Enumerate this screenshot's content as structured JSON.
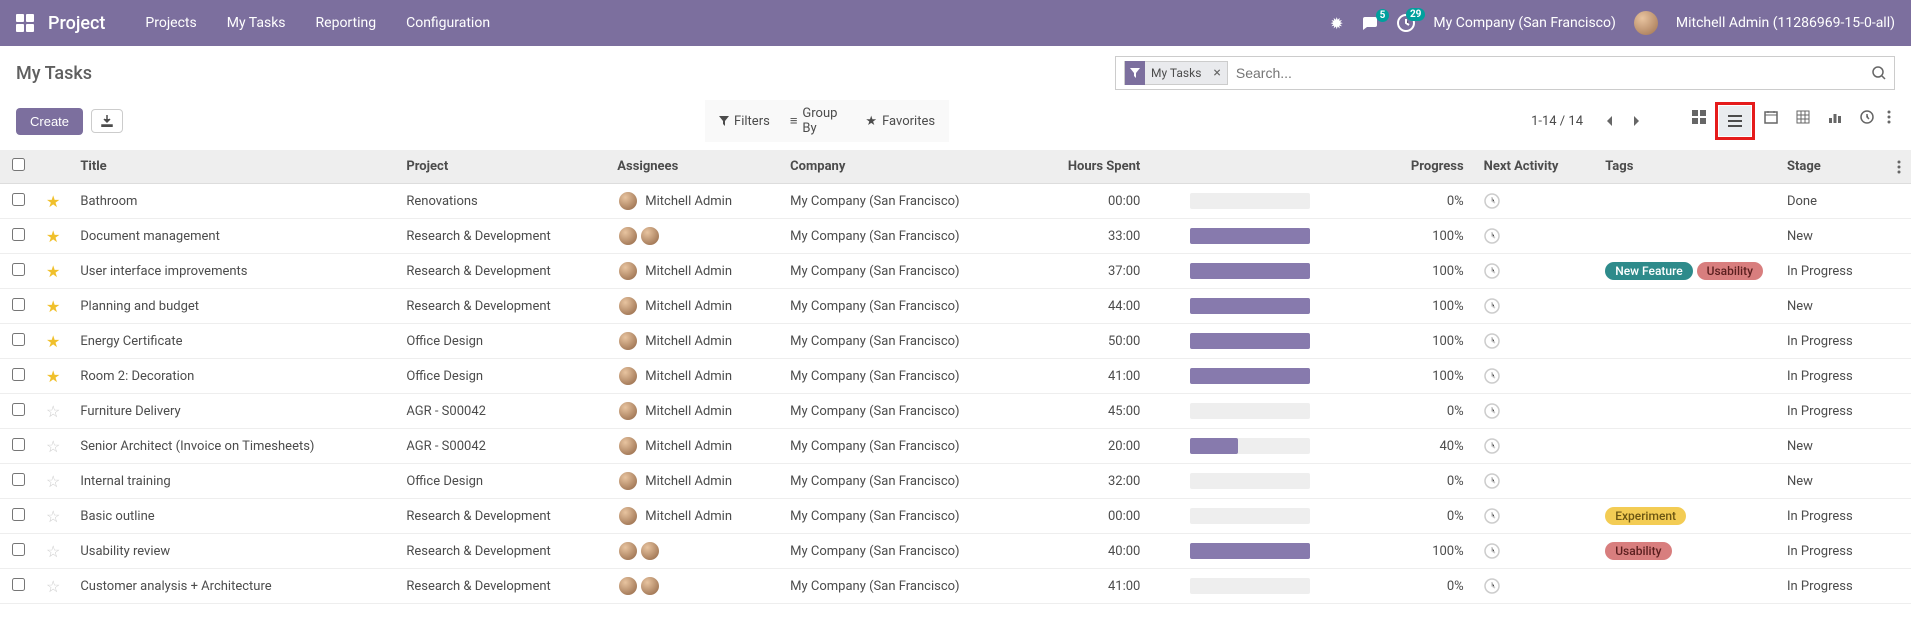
{
  "nav": {
    "brand": "Project",
    "menu": [
      "Projects",
      "My Tasks",
      "Reporting",
      "Configuration"
    ],
    "msg_badge": "5",
    "act_badge": "29",
    "company": "My Company (San Francisco)",
    "user": "Mitchell Admin (11286969-15-0-all)"
  },
  "breadcrumb": "My Tasks",
  "search": {
    "facet_label": "My Tasks",
    "placeholder": "Search..."
  },
  "buttons": {
    "create": "Create",
    "filters": "Filters",
    "groupby": "Group By",
    "favorites": "Favorites"
  },
  "pager": "1-14 / 14",
  "columns": {
    "title": "Title",
    "project": "Project",
    "assignees": "Assignees",
    "company": "Company",
    "hours": "Hours Spent",
    "progress": "Progress",
    "next_activity": "Next Activity",
    "tags": "Tags",
    "stage": "Stage"
  },
  "tag_colors": {
    "New Feature": "tag-teal",
    "Usability": "tag-red",
    "Experiment": "tag-yellow"
  },
  "rows": [
    {
      "star": true,
      "title": "Bathroom",
      "project": "Renovations",
      "assignees": [
        "Mitchell Admin"
      ],
      "show_name": true,
      "company": "My Company (San Francisco)",
      "hours": "00:00",
      "progress_pct": 0,
      "tags": [],
      "stage": "Done"
    },
    {
      "star": true,
      "title": "Document management",
      "project": "Research & Development",
      "assignees": [
        "A",
        "B"
      ],
      "show_name": false,
      "company": "My Company (San Francisco)",
      "hours": "33:00",
      "progress_pct": 100,
      "tags": [],
      "stage": "New"
    },
    {
      "star": true,
      "title": "User interface improvements",
      "project": "Research & Development",
      "assignees": [
        "Mitchell Admin"
      ],
      "show_name": true,
      "company": "My Company (San Francisco)",
      "hours": "37:00",
      "progress_pct": 100,
      "tags": [
        "New Feature",
        "Usability"
      ],
      "stage": "In Progress"
    },
    {
      "star": true,
      "title": "Planning and budget",
      "project": "Research & Development",
      "assignees": [
        "Mitchell Admin"
      ],
      "show_name": true,
      "company": "My Company (San Francisco)",
      "hours": "44:00",
      "progress_pct": 100,
      "tags": [],
      "stage": "New"
    },
    {
      "star": true,
      "title": "Energy Certificate",
      "project": "Office Design",
      "assignees": [
        "Mitchell Admin"
      ],
      "show_name": true,
      "company": "My Company (San Francisco)",
      "hours": "50:00",
      "progress_pct": 100,
      "tags": [],
      "stage": "In Progress"
    },
    {
      "star": true,
      "title": "Room 2: Decoration",
      "project": "Office Design",
      "assignees": [
        "Mitchell Admin"
      ],
      "show_name": true,
      "company": "My Company (San Francisco)",
      "hours": "41:00",
      "progress_pct": 100,
      "tags": [],
      "stage": "In Progress"
    },
    {
      "star": false,
      "title": "Furniture Delivery",
      "project": "AGR - S00042",
      "assignees": [
        "Mitchell Admin"
      ],
      "show_name": true,
      "company": "My Company (San Francisco)",
      "hours": "45:00",
      "progress_pct": 0,
      "tags": [],
      "stage": "In Progress"
    },
    {
      "star": false,
      "title": "Senior Architect (Invoice on Timesheets)",
      "project": "AGR - S00042",
      "assignees": [
        "Mitchell Admin"
      ],
      "show_name": true,
      "company": "My Company (San Francisco)",
      "hours": "20:00",
      "progress_pct": 40,
      "tags": [],
      "stage": "New"
    },
    {
      "star": false,
      "title": "Internal training",
      "project": "Office Design",
      "assignees": [
        "Mitchell Admin"
      ],
      "show_name": true,
      "company": "My Company (San Francisco)",
      "hours": "32:00",
      "progress_pct": 0,
      "tags": [],
      "stage": "New"
    },
    {
      "star": false,
      "title": "Basic outline",
      "project": "Research & Development",
      "assignees": [
        "Mitchell Admin"
      ],
      "show_name": true,
      "company": "My Company (San Francisco)",
      "hours": "00:00",
      "progress_pct": 0,
      "tags": [
        "Experiment"
      ],
      "stage": "In Progress"
    },
    {
      "star": false,
      "title": "Usability review",
      "project": "Research & Development",
      "assignees": [
        "A",
        "B"
      ],
      "show_name": false,
      "company": "My Company (San Francisco)",
      "hours": "40:00",
      "progress_pct": 100,
      "tags": [
        "Usability"
      ],
      "stage": "In Progress"
    },
    {
      "star": false,
      "title": "Customer analysis + Architecture",
      "project": "Research & Development",
      "assignees": [
        "A",
        "B"
      ],
      "show_name": false,
      "company": "My Company (San Francisco)",
      "hours": "41:00",
      "progress_pct": 0,
      "tags": [],
      "stage": "In Progress"
    }
  ]
}
